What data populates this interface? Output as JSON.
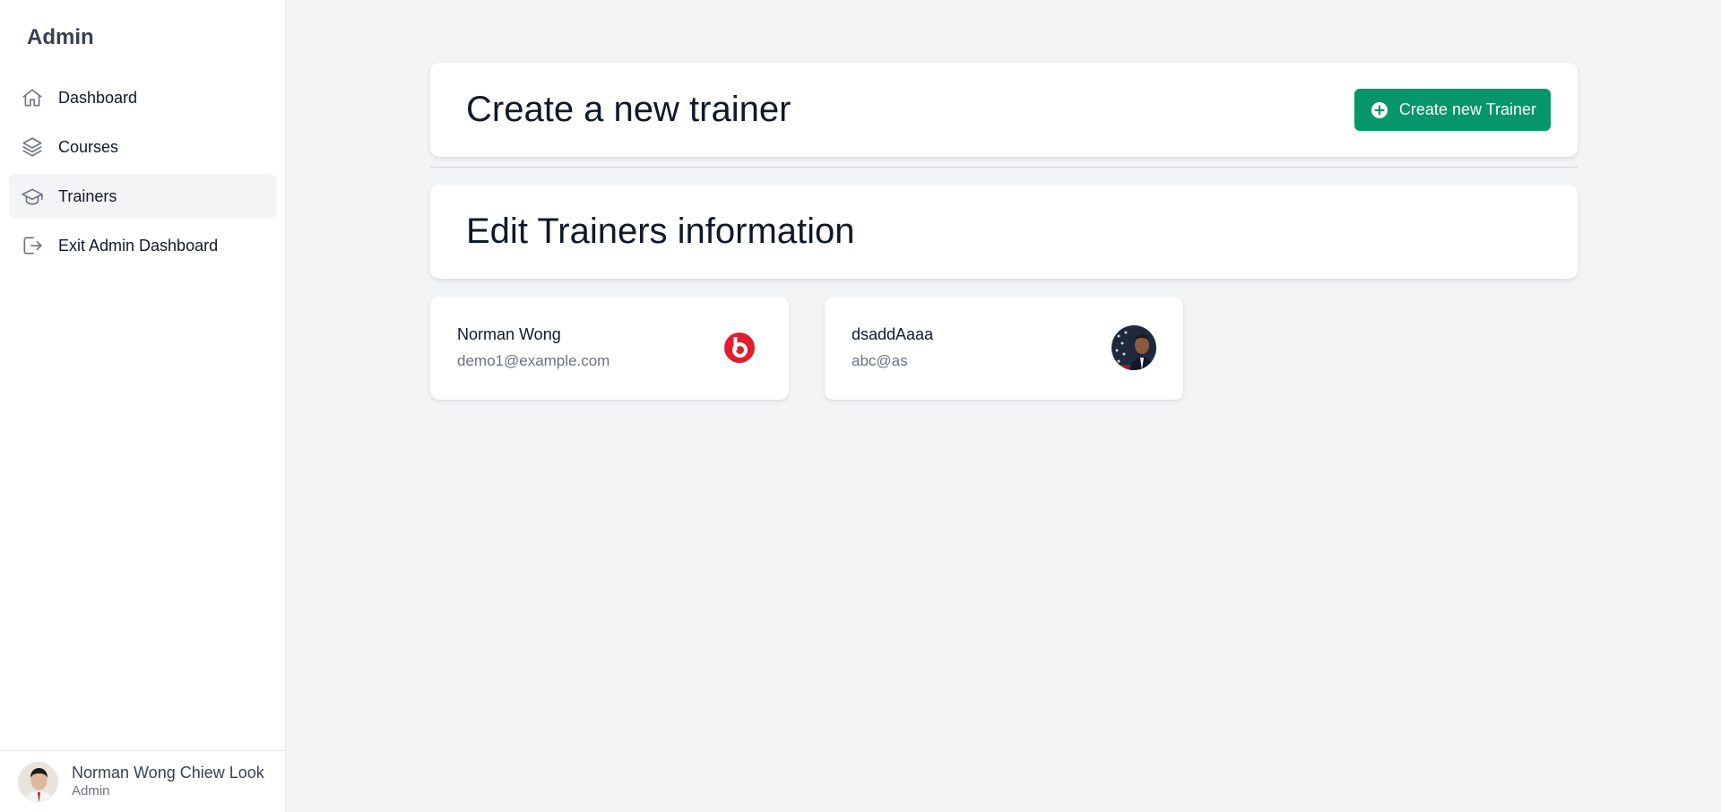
{
  "sidebar": {
    "brand": "Admin",
    "items": [
      {
        "label": "Dashboard",
        "icon": "home-icon"
      },
      {
        "label": "Courses",
        "icon": "layers-icon"
      },
      {
        "label": "Trainers",
        "icon": "graduation-cap-icon",
        "active": true
      },
      {
        "label": "Exit Admin Dashboard",
        "icon": "exit-icon"
      }
    ],
    "user": {
      "name": "Norman Wong Chiew Look",
      "role": "Admin"
    }
  },
  "main": {
    "create_title": "Create a new trainer",
    "create_button_label": "Create new Trainer",
    "edit_title": "Edit Trainers information",
    "trainers": [
      {
        "name": "Norman Wong",
        "email": "demo1@example.com"
      },
      {
        "name": "dsaddAaaa",
        "email": "abc@as"
      }
    ]
  },
  "colors": {
    "accent": "#059669",
    "background": "#f3f4f6",
    "active_nav": "#f3f4f6"
  }
}
